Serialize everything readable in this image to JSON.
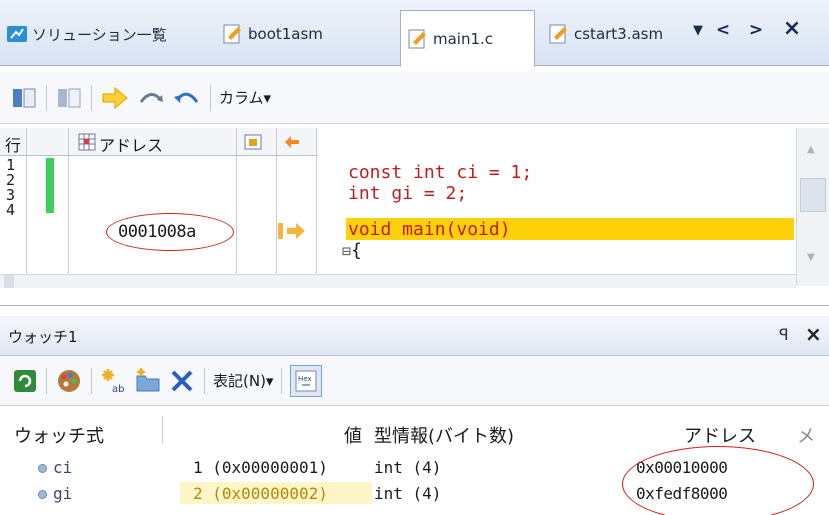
{
  "tabs": [
    {
      "label": "ソリューション一覧"
    },
    {
      "label": "boot1asm"
    },
    {
      "label": "main1.c"
    },
    {
      "label": "cstart3.asm"
    }
  ],
  "tab_controls": {
    "dropdown": "▼",
    "prev": "<",
    "next": ">",
    "close": "×"
  },
  "editor_toolbar": {
    "columns_label": "カラム▾"
  },
  "editor": {
    "header": {
      "line_col": "行",
      "address_col": "アドレス"
    },
    "line_numbers": [
      "1",
      "2",
      "3",
      "4"
    ],
    "address_value": "0001008a",
    "code_lines": [
      "const int ci = 1;",
      "int gi = 2;",
      "void main(void)",
      "{"
    ],
    "fold_marker": "⊟"
  },
  "watch_panel": {
    "title": "ウォッチ1",
    "toolbar": {
      "notation_label": "表記(N)▾"
    },
    "columns": {
      "expr": "ウォッチ式",
      "value": "値",
      "type": "型情報(バイト数)",
      "address": "アドレス",
      "memo": "メ"
    },
    "rows": [
      {
        "name": "ci",
        "value": "1 (0x00000001)",
        "type": "int (4)",
        "address": "0x00010000"
      },
      {
        "name": "gi",
        "value": "2 (0x00000002)",
        "type": "int (4)",
        "address": "0xfedf8000"
      }
    ]
  },
  "colors": {
    "highlight": "#ffd10a",
    "code_red": "#c01c1c",
    "circle_red": "#d42020",
    "breakpoint_green": "#3ccf5e"
  }
}
